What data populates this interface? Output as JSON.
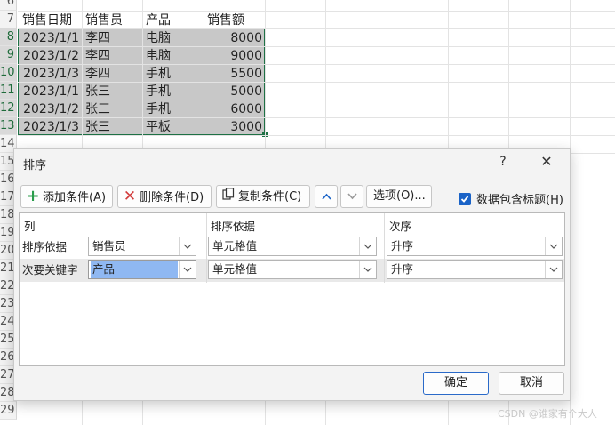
{
  "spreadsheet": {
    "row_numbers": [
      "6",
      "7",
      "8",
      "9",
      "10",
      "11",
      "12",
      "13",
      "14",
      "15",
      "16",
      "17",
      "18",
      "19",
      "20",
      "21",
      "22",
      "23",
      "24",
      "25",
      "26",
      "27",
      "28",
      "29"
    ],
    "header": [
      "销售日期",
      "销售员",
      "产品",
      "销售额"
    ],
    "rows": [
      [
        "2023/1/1",
        "李四",
        "电脑",
        "8000"
      ],
      [
        "2023/1/2",
        "李四",
        "电脑",
        "9000"
      ],
      [
        "2023/1/3",
        "李四",
        "手机",
        "5500"
      ],
      [
        "2023/1/1",
        "张三",
        "手机",
        "5000"
      ],
      [
        "2023/1/2",
        "张三",
        "手机",
        "6000"
      ],
      [
        "2023/1/3",
        "张三",
        "平板",
        "3000"
      ]
    ]
  },
  "dialog": {
    "title": "排序",
    "help": "?",
    "close": "✕",
    "toolbar": {
      "add_label": "添加条件(A)",
      "delete_label": "删除条件(D)",
      "copy_label": "复制条件(C)",
      "options_label": "选项(O)...",
      "header_checkbox_label": "数据包含标题(H)",
      "header_checkbox_checked": true
    },
    "columns": {
      "column_header": "列",
      "sort_on_header": "排序依据",
      "order_header": "次序"
    },
    "criteria": [
      {
        "label": "排序依据",
        "column": "销售员",
        "sort_on": "单元格值",
        "order": "升序"
      },
      {
        "label": "次要关键字",
        "column": "产品",
        "sort_on": "单元格值",
        "order": "升序"
      }
    ],
    "ok_label": "确定",
    "cancel_label": "取消"
  },
  "icons": {
    "add": "plus-icon",
    "delete": "x-icon",
    "copy": "copy-icon",
    "move_up": "chevron-up-icon",
    "move_down": "chevron-down-icon",
    "dropdown": "chevron-down-icon",
    "checkbox": "checkmark-icon"
  },
  "colors": {
    "selection_border": "#1e7145",
    "selection_fill": "#c8c8c8",
    "accent": "#1a63c7",
    "focus_highlight": "#8fb8f2"
  },
  "watermark": "CSDN @谁家有个大人"
}
